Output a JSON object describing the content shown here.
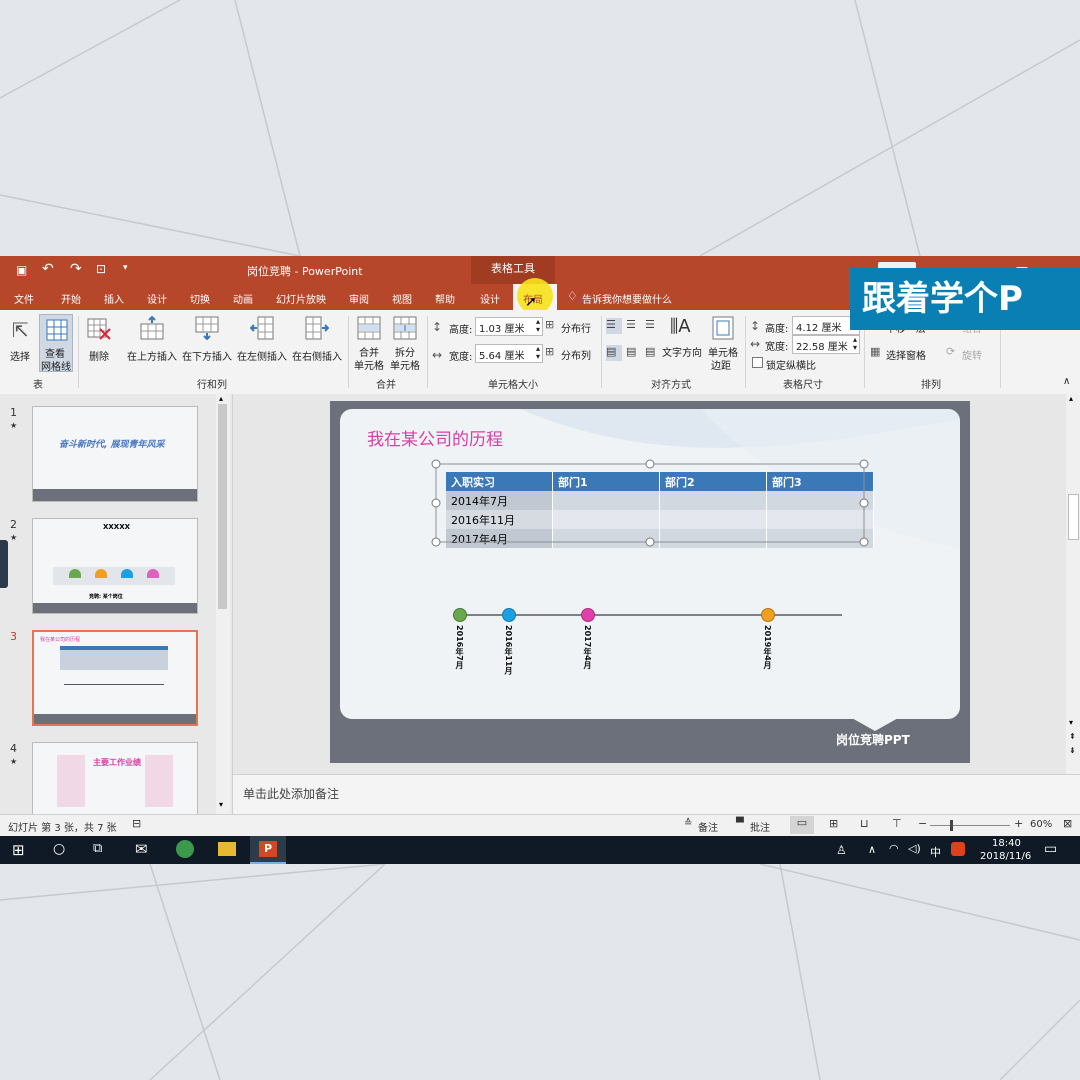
{
  "window": {
    "title": "岗位竞聘  -  PowerPoint",
    "context_tool": "表格工具",
    "tell_me": "告诉我你想要做什么"
  },
  "tabs": [
    "文件",
    "开始",
    "插入",
    "设计",
    "切换",
    "动画",
    "幻灯片放映",
    "审阅",
    "视图",
    "帮助",
    "设计",
    "布局"
  ],
  "ribbon": {
    "select": "选择",
    "view_gridlines_1": "查看",
    "view_gridlines_2": "网格线",
    "delete": "删除",
    "insert_above": "在上方插入",
    "insert_below": "在下方插入",
    "insert_left": "在左侧插入",
    "insert_right": "在右侧插入",
    "merge_cells_1": "合并",
    "merge_cells_2": "单元格",
    "split_cells_1": "拆分",
    "split_cells_2": "单元格",
    "cell_height_label": "高度:",
    "cell_height_value": "1.03 厘米",
    "cell_width_label": "宽度:",
    "cell_width_value": "5.64 厘米",
    "distribute_rows": "分布行",
    "distribute_cols": "分布列",
    "text_direction": "文字方向",
    "cell_margins_1": "单元格",
    "cell_margins_2": "边距",
    "table_height_label": "高度:",
    "table_height_value": "4.12 厘米",
    "table_width_label": "宽度:",
    "table_width_value": "22.58 厘米",
    "lock_aspect": "锁定纵横比",
    "send_backward": "下移一层",
    "group": "组合",
    "selection_pane": "选择窗格",
    "rotate": "旋转",
    "groups": {
      "table": "表",
      "rows_cols": "行和列",
      "merge": "合并",
      "cell_size": "单元格大小",
      "alignment": "对齐方式",
      "table_size": "表格尺寸",
      "arrange": "排列"
    }
  },
  "overlay_text": "跟着学个P",
  "thumbnails": [
    {
      "num": "1",
      "star": "★",
      "title": "奋斗新时代, 展现青年风采"
    },
    {
      "num": "2",
      "star": "★",
      "title": "XXXXX",
      "footer": "竞聘: 某个岗位"
    },
    {
      "num": "3",
      "star": "",
      "title": "我在某公司的历程"
    },
    {
      "num": "4",
      "star": "★",
      "title": "主要工作业绩"
    }
  ],
  "slide": {
    "title": "我在某公司的历程",
    "table": {
      "header": [
        "入职实习",
        "部门1",
        "部门2",
        "部门3"
      ],
      "rows": [
        [
          "2014年7月",
          "",
          "",
          ""
        ],
        [
          "2016年11月",
          "",
          "",
          ""
        ],
        [
          "2017年4月",
          "",
          "",
          ""
        ]
      ]
    },
    "timeline": [
      {
        "label": "2016年7月",
        "color": "#6aa84f"
      },
      {
        "label": "2016年11月",
        "color": "#1ba1e2"
      },
      {
        "label": "2017年4月",
        "color": "#e040a8"
      },
      {
        "label": "2019年4月",
        "color": "#f0a020"
      }
    ],
    "footer": "岗位竞聘PPT"
  },
  "notes_placeholder": "单击此处添加备注",
  "status": {
    "slide_info": "幻灯片 第 3 张，共 7 张",
    "notes": "备注",
    "comments": "批注",
    "zoom": "60%"
  },
  "taskbar": {
    "ime": "中",
    "time": "18:40",
    "date": "2018/11/6"
  },
  "colors": {
    "title_red": "#b7472a",
    "table_header": "#3a78b8",
    "accent_pink": "#d63fa6",
    "overlay_blue": "#0a7fb3"
  }
}
